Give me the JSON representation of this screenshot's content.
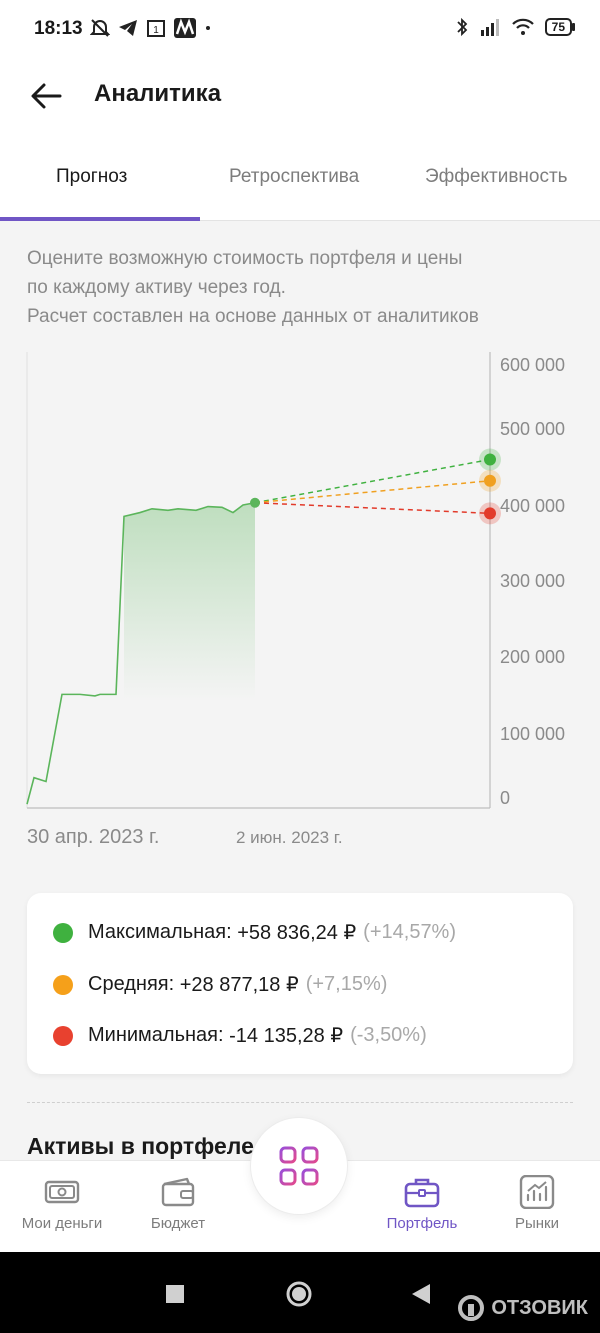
{
  "status_bar": {
    "time": "18:13",
    "battery": "75"
  },
  "header": {
    "title": "Аналитика"
  },
  "tabs": [
    {
      "label": "Прогноз",
      "active": true
    },
    {
      "label": "Ретроспектива",
      "active": false
    },
    {
      "label": "Эффективность",
      "active": false
    }
  ],
  "description": [
    "Оцените возможную стоимость портфеля и цены",
    "по каждому активу через год.",
    "Расчет составлен на основе данных от аналитиков"
  ],
  "chart_data": {
    "type": "line",
    "y_tick_labels": [
      "600 000",
      "500 000",
      "400 000",
      "300 000",
      "200 000",
      "100 000",
      "0"
    ],
    "y_ticks": [
      600000,
      500000,
      400000,
      300000,
      200000,
      100000,
      0
    ],
    "ylim": [
      0,
      600000
    ],
    "x_labels": [
      "30 апр. 2023 г.",
      "2 июн. 2023 г."
    ],
    "history": {
      "values": [
        5000,
        40000,
        35000,
        150000,
        150000,
        148000,
        150000,
        150000,
        385000,
        390000,
        395000,
        393000,
        395000,
        393000,
        398000,
        397000,
        390000,
        400000,
        403000
      ],
      "color": "#5bb55b"
    },
    "forecast": [
      {
        "name": "max",
        "value": 460000,
        "color": "#3fb13f"
      },
      {
        "name": "mid",
        "value": 432000,
        "color": "#f0a020"
      },
      {
        "name": "min",
        "value": 389000,
        "color": "#e23a2a"
      }
    ]
  },
  "legend": [
    {
      "label": "Максимальная:",
      "value": "+58 836,24 ₽",
      "percent": "(+14,57%)",
      "color": "#3fb13f"
    },
    {
      "label": "Средняя:",
      "value": "+28 877,18 ₽",
      "percent": "(+7,15%)",
      "color": "#f5a01a"
    },
    {
      "label": "Минимальная:",
      "value": "-14 135,28 ₽",
      "percent": "(-3,50%)",
      "color": "#e8412f"
    }
  ],
  "section_title": "Активы в портфеле",
  "bottom_nav": [
    {
      "label": "Мои деньги",
      "icon": "money-icon",
      "active": false
    },
    {
      "label": "Бюджет",
      "icon": "wallet-icon",
      "active": false
    },
    {
      "label": "Портфель",
      "icon": "briefcase-icon",
      "active": true
    },
    {
      "label": "Рынки",
      "icon": "chart-up-icon",
      "active": false
    }
  ],
  "colors": {
    "accent": "#7056c5"
  },
  "watermark": "ОТЗОВИК"
}
